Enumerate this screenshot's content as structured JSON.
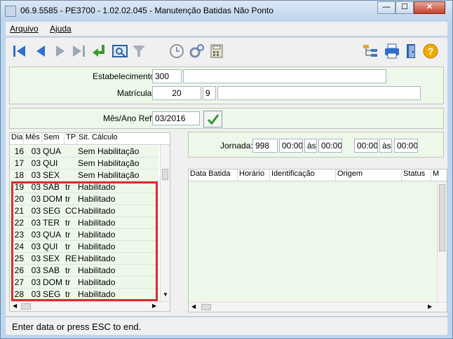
{
  "window": {
    "title": "06.9.5585 - PE3700 - 1.02.02.045 - Manutenção Batidas Não Ponto",
    "minimize": "—",
    "maximize": "☐",
    "close": "✕"
  },
  "menu": {
    "arquivo": "Arquivo",
    "ajuda": "Ajuda"
  },
  "toolbar": {
    "icons": [
      "first-icon",
      "previous-icon",
      "next-icon",
      "last-icon",
      "confirm-return-icon",
      "preview-icon",
      "filter-icon",
      "clock-icon",
      "gears-icon",
      "calculator-icon",
      "tree-icon",
      "printer-icon",
      "exit-door-icon",
      "help-icon"
    ]
  },
  "header": {
    "estabelecimento_label": "Estabelecimento:",
    "estabelecimento_value": "300",
    "estabelecimento_desc": "",
    "matricula_label": "Matrícula:",
    "matricula_value": "20",
    "matricula_digit": "9",
    "matricula_name": ""
  },
  "periodo": {
    "label": "Mês/Ano Ref:",
    "value": "03/2016"
  },
  "days_grid": {
    "columns": [
      "Dia",
      "Mês",
      "Sem",
      "TP",
      "Sit. Cálculo"
    ],
    "rows": [
      {
        "dia": "16",
        "mes": "03",
        "sem": "QUA",
        "tp": "",
        "sit": "Sem Habilitação"
      },
      {
        "dia": "17",
        "mes": "03",
        "sem": "QUI",
        "tp": "",
        "sit": "Sem Habilitação"
      },
      {
        "dia": "18",
        "mes": "03",
        "sem": "SEX",
        "tp": "",
        "sit": "Sem Habilitação"
      },
      {
        "dia": "19",
        "mes": "03",
        "sem": "SAB",
        "tp": "tr",
        "sit": "Habilitado"
      },
      {
        "dia": "20",
        "mes": "03",
        "sem": "DOM",
        "tp": "tr",
        "sit": "Habilitado"
      },
      {
        "dia": "21",
        "mes": "03",
        "sem": "SEG",
        "tp": "CC",
        "sit": "Habilitado"
      },
      {
        "dia": "22",
        "mes": "03",
        "sem": "TER",
        "tp": "tr",
        "sit": "Habilitado"
      },
      {
        "dia": "23",
        "mes": "03",
        "sem": "QUA",
        "tp": "tr",
        "sit": "Habilitado"
      },
      {
        "dia": "24",
        "mes": "03",
        "sem": "QUI",
        "tp": "tr",
        "sit": "Habilitado"
      },
      {
        "dia": "25",
        "mes": "03",
        "sem": "SEX",
        "tp": "RE",
        "sit": "Habilitado"
      },
      {
        "dia": "26",
        "mes": "03",
        "sem": "SAB",
        "tp": "tr",
        "sit": "Habilitado"
      },
      {
        "dia": "27",
        "mes": "03",
        "sem": "DOM",
        "tp": "tr",
        "sit": "Habilitado"
      },
      {
        "dia": "28",
        "mes": "03",
        "sem": "SEG",
        "tp": "tr",
        "sit": "Habilitado"
      }
    ]
  },
  "jornada": {
    "label": "Jornada:",
    "code": "998",
    "t1": "00:00",
    "as1": "às",
    "t2": "00:00",
    "t3": "00:00",
    "as2": "às",
    "t4": "00:00"
  },
  "batidas_grid": {
    "columns": [
      "Data Batida",
      "Horário",
      "Identificação",
      "Origem",
      "Status",
      "M"
    ]
  },
  "status_bar": {
    "message": "Enter data or press ESC to end."
  },
  "colors": {
    "panel": "#edf8ea",
    "highlight": "#e02a2a",
    "title_gradient": "#bcd3ea"
  }
}
